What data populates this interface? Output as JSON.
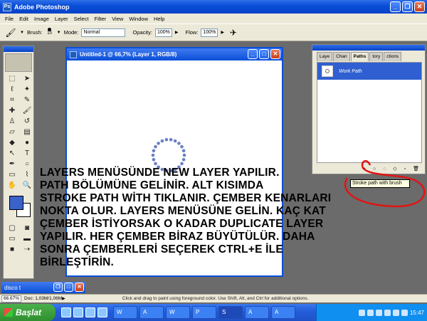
{
  "app": {
    "title": "Adobe Photoshop",
    "icon_letters": "Ps"
  },
  "menu": [
    "File",
    "Edit",
    "Image",
    "Layer",
    "Select",
    "Filter",
    "View",
    "Window",
    "Help"
  ],
  "options": {
    "brush_label": "Brush:",
    "brush_size": "10",
    "mode_label": "Mode:",
    "mode_value": "Normal",
    "opacity_label": "Opacity:",
    "opacity_value": "100%",
    "flow_label": "Flow:",
    "flow_value": "100%"
  },
  "document": {
    "title": "Untitled-1 @ 66,7% (Layer 1, RGB/8)",
    "dot_color": "#6a7fc4"
  },
  "palette": {
    "tabs": [
      "Laye",
      "Chan",
      "Paths",
      "tory",
      "ctions"
    ],
    "active_tab": "Paths",
    "work_path_label": "Work Path"
  },
  "tooltip": "Stroke path with brush",
  "overlay_lines": [
    "LAYERS MENÜSÜNDE NEW LAYER YAPILIR.",
    "PATH BÖLÜMÜNE GELİNİR. ALT KISIMDA",
    "STROKE PATH WİTH TIKLANIR. ÇEMBER KENARLARI",
    "NOKTA OLUR. LAYERS MENÜSÜNE GELİN. KAÇ KAT",
    "ÇEMBER İSTİYORSAK O KADAR DUPLICATE LAYER",
    "YAPILIR. HER ÇEMBER BİRAZ BÜYÜTÜLÜR. DAHA",
    "SONRA ÇEMBERLERİ SEÇEREK CTRL+E İLE",
    "BİRLEŞTİRİN."
  ],
  "minimized_window": "disco t",
  "status": {
    "zoom": "66.67%",
    "doc": "Doc: 1,03M/1,06M",
    "hint": "Click and drag to paint using foreground color. Use Shift, Alt, and Ctrl for additional options."
  },
  "taskbar": {
    "start_label": "Başlat",
    "buttons": [
      "W",
      "A",
      "W",
      "P",
      "S",
      "A",
      "A"
    ],
    "clock": "15:47"
  },
  "colors": {
    "foreground": "#3b62c9",
    "background": "#ffffff",
    "annotation_red": "#e01515"
  }
}
